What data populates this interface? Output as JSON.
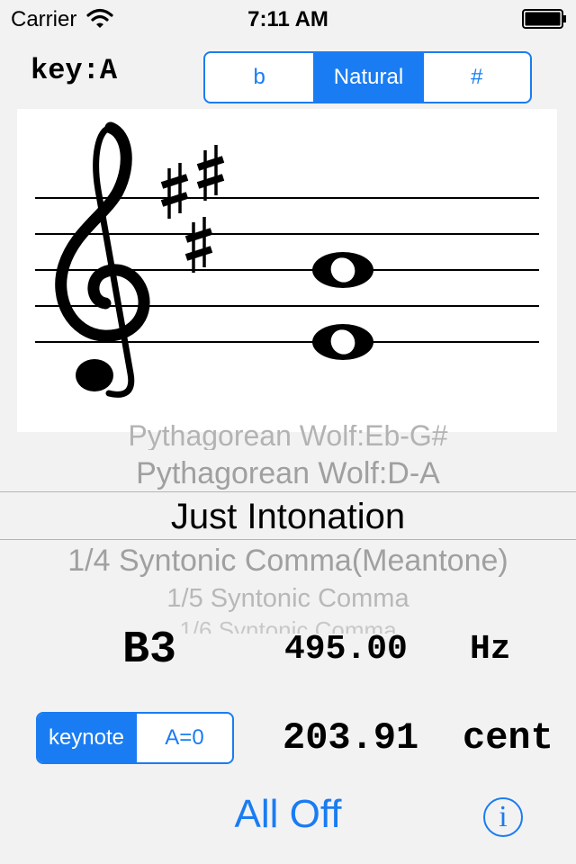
{
  "status_bar": {
    "carrier": "Carrier",
    "time": "7:11 AM"
  },
  "key": {
    "label": "key:A"
  },
  "accidental_control": {
    "options": [
      "b",
      "Natural",
      "#"
    ],
    "selected_index": 1
  },
  "notation": {
    "clef": "treble",
    "key_signature": "A major (3 sharps)",
    "chord_notes": [
      "B",
      "F#"
    ],
    "marker_color": "#f2a60f"
  },
  "temperament_picker": {
    "items_above": [
      "Pythagorean Wolf:Eb-G#",
      "Pythagorean Wolf:D-A"
    ],
    "selected": "Just Intonation",
    "items_below": [
      "1/4 Syntonic Comma(Meantone)",
      "1/5 Syntonic Comma",
      "1/6 Syntonic Comma"
    ]
  },
  "readout": {
    "note": "B3",
    "frequency": "495.00",
    "frequency_unit": "Hz",
    "cents": "203.91",
    "cents_unit": "cent"
  },
  "reference_control": {
    "options": [
      "keynote",
      "A=0"
    ],
    "selected_index": 0
  },
  "all_off_label": "All Off",
  "info_label": "i",
  "colors": {
    "accent": "#1a7cf2",
    "background": "#f2f2f2",
    "marker": "#f2a60f"
  }
}
